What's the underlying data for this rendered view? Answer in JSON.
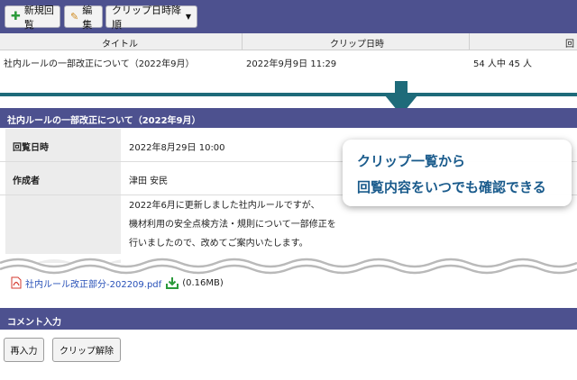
{
  "toolbar": {
    "new_label": "新規回覧",
    "edit_label": "編集",
    "sort_label": "クリップ日時降順",
    "colors": {
      "bar": "#4d518f",
      "new_icon": "#2a9a3a",
      "edit_icon": "#d08a1e"
    }
  },
  "list": {
    "columns": [
      "タイトル",
      "クリップ日時",
      "回"
    ],
    "rows": [
      {
        "title": "社内ルールの一部改正について（2022年9月）",
        "clip_date": "2022年9月9日 11:29",
        "count": "54 人中 45 人"
      }
    ]
  },
  "detail": {
    "header": "社内ルールの一部改正について（2022年9月）",
    "fields": [
      {
        "label": "回覧日時",
        "value": "2022年8月29日 10:00"
      },
      {
        "label": "作成者",
        "value": "津田 安民"
      }
    ],
    "body_lines": [
      "2022年6月に更新しました社内ルールですが、",
      "機材利用の安全点検方法・規則について一部修正を",
      "行いましたので、改めてご案内いたします。"
    ]
  },
  "callout": {
    "line1": "クリップ一覧から",
    "line2": "回覧内容をいつでも確認できる"
  },
  "attachment": {
    "filename": "社内ルール改正部分-202209.pdf",
    "size": "(0.16MB)"
  },
  "comment": {
    "header": "コメント入力"
  },
  "buttons": {
    "reinput": "再入力",
    "unclip": "クリップ解除"
  }
}
